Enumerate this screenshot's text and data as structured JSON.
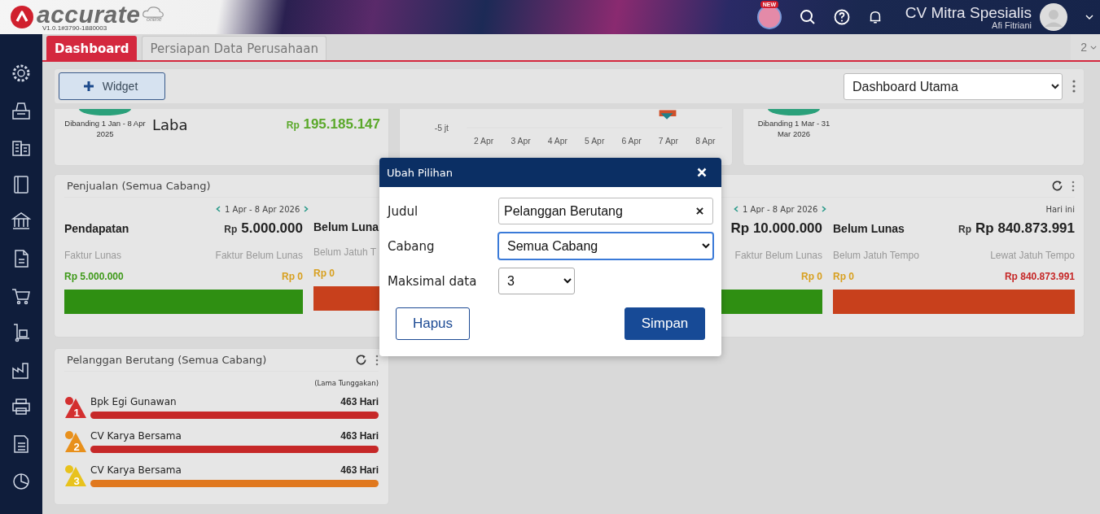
{
  "header": {
    "logo": "accurate",
    "logo_sub": "online",
    "version": "V1.0.1#3790-1880003",
    "badge": "NEW",
    "company": "CV Mitra Spesialis",
    "user": "Afi Fitriani"
  },
  "tabs": [
    {
      "label": "Dashboard",
      "selected": true
    },
    {
      "label": "Persiapan Data Perusahaan",
      "selected": false
    }
  ],
  "tab_count": "2",
  "toolbar": {
    "add_button": "Widget",
    "dashboard_select": "Dashboard Utama"
  },
  "summary_cards": [
    {
      "kind": "profit",
      "comparison": "Dibanding 1 Jan - 8 Apr 2025",
      "label": "Laba",
      "currency": "Rp",
      "amount": "195.185.147"
    },
    {
      "kind": "chart",
      "y_tick": "-5 jt",
      "x_labels": [
        "2 Apr",
        "3 Apr",
        "4 Apr",
        "5 Apr",
        "6 Apr",
        "7 Apr",
        "8 Apr"
      ]
    },
    {
      "kind": "gauge",
      "comparison": "Dibanding 1 Mar - 31 Mar 2026"
    }
  ],
  "sales_widgets": [
    {
      "title": "Penjualan (Semua Cabang)",
      "period": "1 Apr - 8 Apr 2026",
      "halves": [
        {
          "kind": "income",
          "label": "Pendapatan",
          "currency": "Rp",
          "amount": "5.000.000",
          "left_label": "Faktur Lunas",
          "right_label": "Faktur Belum Lunas",
          "left_value": "Rp 5.000.000",
          "right_value": "Rp 0"
        },
        {
          "kind": "receivable",
          "label": "Belum Luna",
          "left_label": "Belum Jatuh T",
          "left_value": "Rp 0"
        }
      ]
    },
    {
      "period": "1 Apr - 8 Apr 2026",
      "period_note": "Hari ini",
      "halves": [
        {
          "kind": "income",
          "amount": "Rp 10.000.000",
          "right_label": "Faktur Belum Lunas",
          "right_value": "Rp 0"
        },
        {
          "kind": "receivable",
          "label": "Belum Lunas",
          "currency": "Rp",
          "amount": "Rp 840.873.991",
          "left_label": "Belum Jatuh Tempo",
          "right_label": "Lewat Jatuh Tempo",
          "left_value": "Rp 0",
          "right_value": "Rp 840.873.991"
        }
      ]
    }
  ],
  "debtors": {
    "title": "Pelanggan Berutang (Semua Cabang)",
    "column_note": "(Lama Tunggakan)",
    "rows": [
      {
        "rank": "1",
        "name": "Bpk Egi Gunawan",
        "days": "463 Hari",
        "color": "#c62828"
      },
      {
        "rank": "2",
        "name": "CV Karya Bersama",
        "days": "463 Hari",
        "color": "#c62828"
      },
      {
        "rank": "3",
        "name": "CV Karya Bersama",
        "days": "463 Hari",
        "color": "#e0781e"
      }
    ]
  },
  "modal": {
    "title": "Ubah Pilihan",
    "fields": [
      {
        "kind": "text",
        "label": "Judul",
        "value": "Pelanggan Berutang",
        "focused": false
      },
      {
        "kind": "select",
        "label": "Cabang",
        "value": "Semua Cabang",
        "focused": true
      },
      {
        "kind": "small_select",
        "label": "Maksimal data",
        "value": "3",
        "focused": false
      }
    ],
    "buttons": [
      {
        "kind": "secondary",
        "label": "Hapus"
      },
      {
        "kind": "primary",
        "label": "Simpan"
      }
    ]
  }
}
